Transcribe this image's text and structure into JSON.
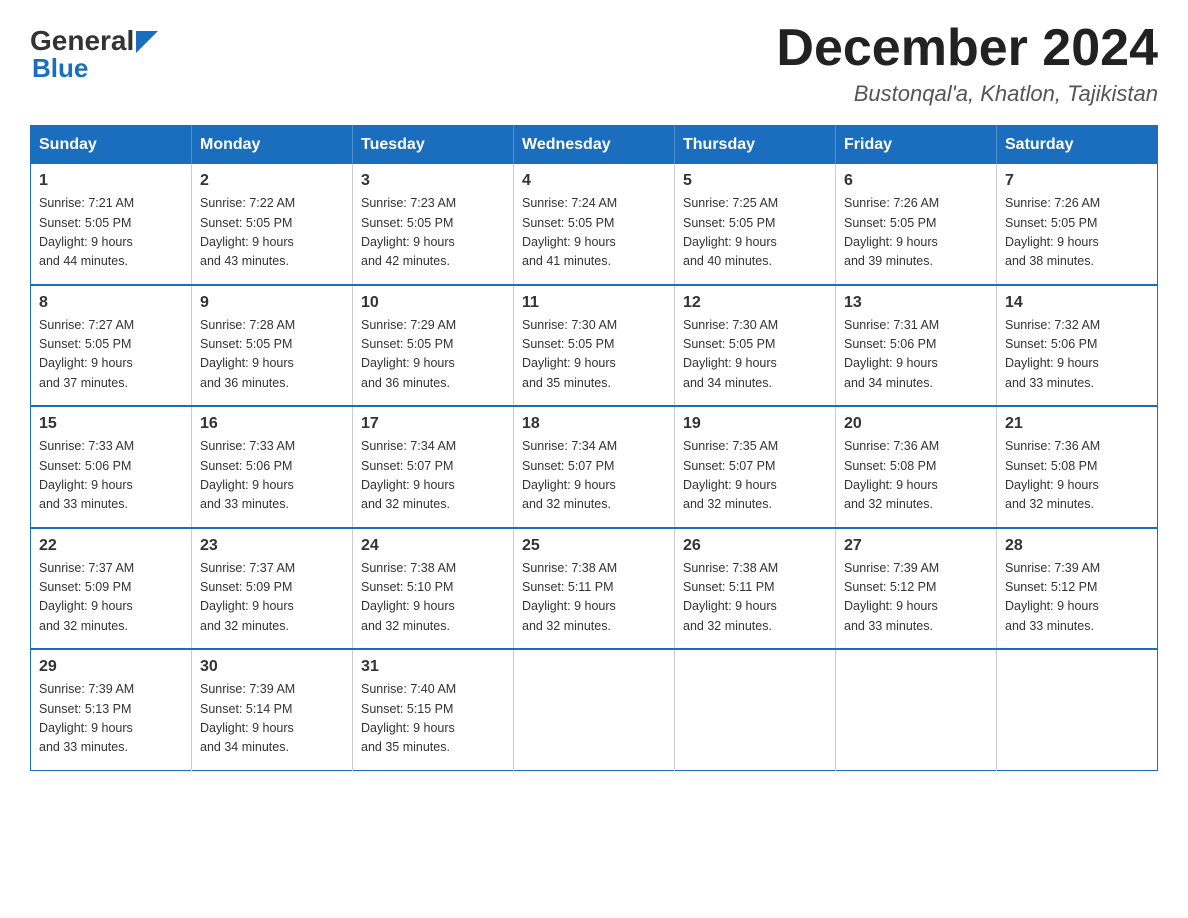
{
  "header": {
    "logo_general": "General",
    "logo_blue": "Blue",
    "month_title": "December 2024",
    "location": "Bustonqal'a, Khatlon, Tajikistan"
  },
  "days_of_week": [
    "Sunday",
    "Monday",
    "Tuesday",
    "Wednesday",
    "Thursday",
    "Friday",
    "Saturday"
  ],
  "weeks": [
    [
      {
        "day": "1",
        "sunrise": "7:21 AM",
        "sunset": "5:05 PM",
        "daylight": "9 hours and 44 minutes."
      },
      {
        "day": "2",
        "sunrise": "7:22 AM",
        "sunset": "5:05 PM",
        "daylight": "9 hours and 43 minutes."
      },
      {
        "day": "3",
        "sunrise": "7:23 AM",
        "sunset": "5:05 PM",
        "daylight": "9 hours and 42 minutes."
      },
      {
        "day": "4",
        "sunrise": "7:24 AM",
        "sunset": "5:05 PM",
        "daylight": "9 hours and 41 minutes."
      },
      {
        "day": "5",
        "sunrise": "7:25 AM",
        "sunset": "5:05 PM",
        "daylight": "9 hours and 40 minutes."
      },
      {
        "day": "6",
        "sunrise": "7:26 AM",
        "sunset": "5:05 PM",
        "daylight": "9 hours and 39 minutes."
      },
      {
        "day": "7",
        "sunrise": "7:26 AM",
        "sunset": "5:05 PM",
        "daylight": "9 hours and 38 minutes."
      }
    ],
    [
      {
        "day": "8",
        "sunrise": "7:27 AM",
        "sunset": "5:05 PM",
        "daylight": "9 hours and 37 minutes."
      },
      {
        "day": "9",
        "sunrise": "7:28 AM",
        "sunset": "5:05 PM",
        "daylight": "9 hours and 36 minutes."
      },
      {
        "day": "10",
        "sunrise": "7:29 AM",
        "sunset": "5:05 PM",
        "daylight": "9 hours and 36 minutes."
      },
      {
        "day": "11",
        "sunrise": "7:30 AM",
        "sunset": "5:05 PM",
        "daylight": "9 hours and 35 minutes."
      },
      {
        "day": "12",
        "sunrise": "7:30 AM",
        "sunset": "5:05 PM",
        "daylight": "9 hours and 34 minutes."
      },
      {
        "day": "13",
        "sunrise": "7:31 AM",
        "sunset": "5:06 PM",
        "daylight": "9 hours and 34 minutes."
      },
      {
        "day": "14",
        "sunrise": "7:32 AM",
        "sunset": "5:06 PM",
        "daylight": "9 hours and 33 minutes."
      }
    ],
    [
      {
        "day": "15",
        "sunrise": "7:33 AM",
        "sunset": "5:06 PM",
        "daylight": "9 hours and 33 minutes."
      },
      {
        "day": "16",
        "sunrise": "7:33 AM",
        "sunset": "5:06 PM",
        "daylight": "9 hours and 33 minutes."
      },
      {
        "day": "17",
        "sunrise": "7:34 AM",
        "sunset": "5:07 PM",
        "daylight": "9 hours and 32 minutes."
      },
      {
        "day": "18",
        "sunrise": "7:34 AM",
        "sunset": "5:07 PM",
        "daylight": "9 hours and 32 minutes."
      },
      {
        "day": "19",
        "sunrise": "7:35 AM",
        "sunset": "5:07 PM",
        "daylight": "9 hours and 32 minutes."
      },
      {
        "day": "20",
        "sunrise": "7:36 AM",
        "sunset": "5:08 PM",
        "daylight": "9 hours and 32 minutes."
      },
      {
        "day": "21",
        "sunrise": "7:36 AM",
        "sunset": "5:08 PM",
        "daylight": "9 hours and 32 minutes."
      }
    ],
    [
      {
        "day": "22",
        "sunrise": "7:37 AM",
        "sunset": "5:09 PM",
        "daylight": "9 hours and 32 minutes."
      },
      {
        "day": "23",
        "sunrise": "7:37 AM",
        "sunset": "5:09 PM",
        "daylight": "9 hours and 32 minutes."
      },
      {
        "day": "24",
        "sunrise": "7:38 AM",
        "sunset": "5:10 PM",
        "daylight": "9 hours and 32 minutes."
      },
      {
        "day": "25",
        "sunrise": "7:38 AM",
        "sunset": "5:11 PM",
        "daylight": "9 hours and 32 minutes."
      },
      {
        "day": "26",
        "sunrise": "7:38 AM",
        "sunset": "5:11 PM",
        "daylight": "9 hours and 32 minutes."
      },
      {
        "day": "27",
        "sunrise": "7:39 AM",
        "sunset": "5:12 PM",
        "daylight": "9 hours and 33 minutes."
      },
      {
        "day": "28",
        "sunrise": "7:39 AM",
        "sunset": "5:12 PM",
        "daylight": "9 hours and 33 minutes."
      }
    ],
    [
      {
        "day": "29",
        "sunrise": "7:39 AM",
        "sunset": "5:13 PM",
        "daylight": "9 hours and 33 minutes."
      },
      {
        "day": "30",
        "sunrise": "7:39 AM",
        "sunset": "5:14 PM",
        "daylight": "9 hours and 34 minutes."
      },
      {
        "day": "31",
        "sunrise": "7:40 AM",
        "sunset": "5:15 PM",
        "daylight": "9 hours and 35 minutes."
      },
      null,
      null,
      null,
      null
    ]
  ],
  "sunrise_label": "Sunrise:",
  "sunset_label": "Sunset:",
  "daylight_label": "Daylight:"
}
